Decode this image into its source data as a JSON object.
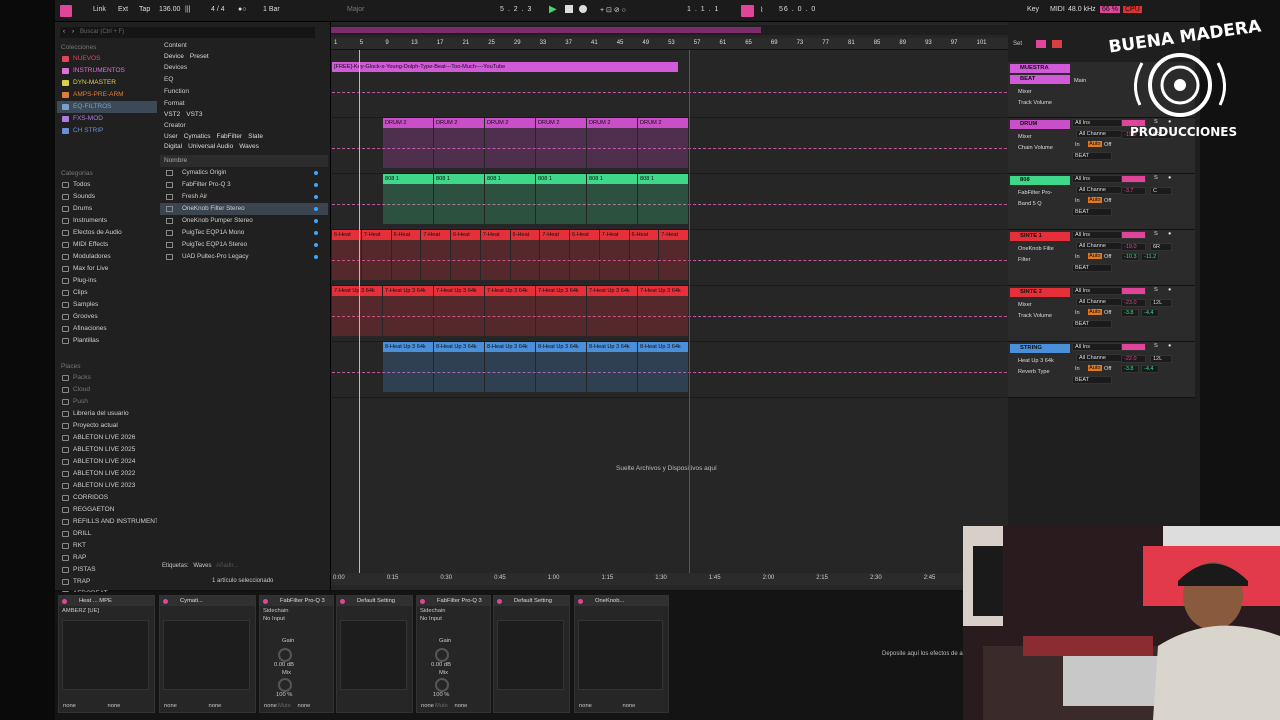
{
  "topbar": {
    "link": "Link",
    "ext": "Ext",
    "tap": "Tap",
    "tempo": "136.00",
    "signature": "4 / 4",
    "quantize": "1 Bar",
    "key_scale": "Major",
    "position": "5 . 2 . 3",
    "loop_start": "1 . 1 . 1",
    "loop_len": "56 . 0 . 0",
    "key": "Key",
    "midi": "MIDI",
    "sample_rate": "48.0 kHz",
    "cpu_pct": "66 %",
    "cpu": "CPU"
  },
  "browser": {
    "search_placeholder": "Buscar (Ctrl + F)",
    "collections_title": "Colecciones",
    "collections": [
      {
        "label": "NUEVOS",
        "color": "#e0455a"
      },
      {
        "label": "INSTRUMENTOS",
        "color": "#e06fd8"
      },
      {
        "label": "DYN-MASTER",
        "color": "#d9d14a"
      },
      {
        "label": "AMPS-PRE-ARM",
        "color": "#e07c3a"
      },
      {
        "label": "EQ-FILTROS",
        "color": "#7aa0c9"
      },
      {
        "label": "FXS-MOD",
        "color": "#b07be0"
      },
      {
        "label": "CH STRIP",
        "color": "#6a8fd6"
      }
    ],
    "categories_title": "Categorías",
    "categories": [
      "Todos",
      "Sounds",
      "Drums",
      "Instruments",
      "Efectos de Audio",
      "MIDI Effects",
      "Moduladores",
      "Max for Live",
      "Plug-ins",
      "Clips",
      "Samples",
      "Grooves",
      "Afinaciones",
      "Plantillas"
    ],
    "places_title": "Places",
    "places": [
      "Packs",
      "Cloud",
      "Push",
      "Librería del usuario",
      "Proyecto actual",
      "ABLETON LIVE 2026",
      "ABLETON LIVE 2025",
      "ABLETON LIVE 2024",
      "ABLETON LIVE 2022",
      "ABLETON LIVE  2023",
      "CORRIDOS",
      "REGGAETON",
      "REFILLS AND INSTRUMENT",
      "DRILL",
      "RKT",
      "RAP",
      "PISTAS",
      "TRAP",
      "AFROBEAT"
    ],
    "filters": [
      {
        "head": "Content",
        "items": [
          "Device",
          "Preset"
        ]
      },
      {
        "head": "Devices",
        "items": []
      },
      {
        "head": "EQ",
        "items": []
      },
      {
        "head": "Function",
        "items": []
      },
      {
        "head": "Format",
        "items": [
          "VST2",
          "VST3"
        ]
      },
      {
        "head": "Creator",
        "items": [
          "User",
          "Cymatics",
          "FabFilter",
          "Slate Digital",
          "Universal Audio",
          "Waves"
        ]
      }
    ],
    "name_header": "Nombre",
    "names": [
      "Cymatics Origin",
      "FabFilter Pro-Q 3",
      "Fresh Air",
      "OneKnob Filter Stereo",
      "OneKnob Pumper Stereo",
      "PuigTec EQP1A Mono",
      "PuigTec EQP1A Stereo",
      "UAD Pultec-Pro Legacy"
    ],
    "tags_label": "Etiquetas:",
    "tag": "Waves",
    "tag_add": "Añadir...",
    "status": "1 artículo seleccionado"
  },
  "ruler": [
    "1",
    "5",
    "9",
    "13",
    "17",
    "21",
    "25",
    "29",
    "33",
    "37",
    "41",
    "45",
    "49",
    "53",
    "57",
    "61",
    "65",
    "69",
    "73",
    "77",
    "81",
    "85",
    "89",
    "93",
    "97",
    "101"
  ],
  "set_label": "Set",
  "tracks": [
    {
      "clips": [
        "[FREE]-Key-Glock-x-Young-Dolph-Type-Beat---Too-Much----YouTube"
      ],
      "color": "#d05ad8"
    },
    {
      "clips": [
        "DRUM 2",
        "DRUM 2",
        "DRUM 2",
        "DRUM 2",
        "DRUM 2",
        "DRUM 2"
      ],
      "color": "#c94fc9"
    },
    {
      "clips": [
        "808 1",
        "808 1",
        "808 1",
        "808 1",
        "808 1",
        "808 1"
      ],
      "color": "#3fd88a"
    },
    {
      "clips": [
        "6-Heat",
        "7-Heat",
        "6-Heat",
        "7-Heat",
        "6-Heat",
        "7-Heat",
        "6-Heat",
        "7-Heat",
        "6-Heat",
        "7-Heat",
        "6-Heat",
        "7-Heat"
      ],
      "color": "#e5303a"
    },
    {
      "clips": [
        "7-Heat Up 3 64k",
        "7-Heat Up 3 64k",
        "7-Heat Up 3 64k",
        "7-Heat Up 3 64k",
        "7-Heat Up 3 64k",
        "7-Heat Up 3 64k",
        "7-Heat Up 3 64k"
      ],
      "color": "#e5303a"
    },
    {
      "clips": [
        "8-Heat Up 3 64k",
        "8-Heat Up 3 64k",
        "8-Heat Up 3 64k",
        "8-Heat Up 3 64k",
        "8-Heat Up 3 64k",
        "8-Heat Up 3 64k"
      ],
      "color": "#4a8fd9"
    }
  ],
  "headers": [
    {
      "name": "MUESTRA",
      "sub": "BEAT",
      "color": "#d05ad8",
      "f1": "Mixer",
      "f2": "Track Volume",
      "io": "Main"
    },
    {
      "name": "DRUM",
      "color": "#c94fc9",
      "f1": "Mixer",
      "f2": "Chain Volume",
      "in": "All Ins",
      "ch": "All Channe",
      "out": "BEAT",
      "vol": "-19.0",
      "pan": "6R"
    },
    {
      "name": "808",
      "color": "#3fd88a",
      "f1": "FabFilter Pro-",
      "f2": "Band 5 Q",
      "in": "All Ins",
      "ch": "All Channe",
      "out": "BEAT",
      "vol": "-3.7",
      "pan": "C"
    },
    {
      "name": "SINTE 1",
      "color": "#e5303a",
      "f1": "OneKnob Filte",
      "f2": "Filter",
      "in": "All Ins",
      "ch": "All Channe",
      "out": "BEAT",
      "vol": "-19.0",
      "pan": "6R",
      "extra": "-10.3",
      "extra2": "-11.2"
    },
    {
      "name": "SINTE 2",
      "color": "#e5303a",
      "f1": "Mixer",
      "f2": "Track Volume",
      "in": "All Ins",
      "ch": "All Channe",
      "out": "BEAT",
      "vol": "-23.0",
      "pan": "12L",
      "extra": "-3.8",
      "extra2": "-4.4"
    },
    {
      "name": "STRING",
      "color": "#4a8fd9",
      "f1": "Heat Up 3 64k",
      "f2": "Reverb Type",
      "in": "All Ins",
      "ch": "All Channe",
      "out": "BEAT",
      "vol": "-22.0",
      "pan": "12L",
      "extra": "-3.8",
      "extra2": "-4.4"
    }
  ],
  "io_labels": {
    "in": "In",
    "auto": "Auto",
    "off": "Off"
  },
  "drop_text": "Suelte Archivos y Dispositivos aquí",
  "time_ruler": [
    "0:00",
    "0:15",
    "0:30",
    "0:45",
    "1:00",
    "1:15",
    "1:30",
    "1:45",
    "2:00",
    "2:15",
    "2:30",
    "2:45"
  ],
  "devices": [
    {
      "title": "Heat ... MPE",
      "sub": "AMBERZ [UE]",
      "f1": "none",
      "f2": "none"
    },
    {
      "title": "Cymati...",
      "sub": "",
      "f1": "none",
      "f2": "none"
    },
    {
      "title": "FabFilter Pro-Q 3",
      "sub": "Sidechain",
      "input": "No Input",
      "gain": "Gain",
      "gain_v": "0.00 dB",
      "mix": "Mix",
      "mix_v": "100 %",
      "f1": "none",
      "f2": "none",
      "mute": "Mute"
    },
    {
      "title": "Default Setting",
      "sub": ""
    },
    {
      "title": "FabFilter Pro-Q 3",
      "sub": "Sidechain",
      "input": "No Input",
      "gain": "Gain",
      "gain_v": "0.00 dB",
      "mix": "Mix",
      "mix_v": "100 %",
      "f1": "none",
      "f2": "none",
      "mute": "Mute"
    },
    {
      "title": "Default Setting",
      "sub": ""
    },
    {
      "title": "OneKnob...",
      "sub": "",
      "f1": "none",
      "f2": "none"
    }
  ],
  "drop_devices": "Deposite aquí los efectos de audio",
  "logo": {
    "line1": "BUENA MADERA",
    "line2": "PRODUCCIONES"
  }
}
